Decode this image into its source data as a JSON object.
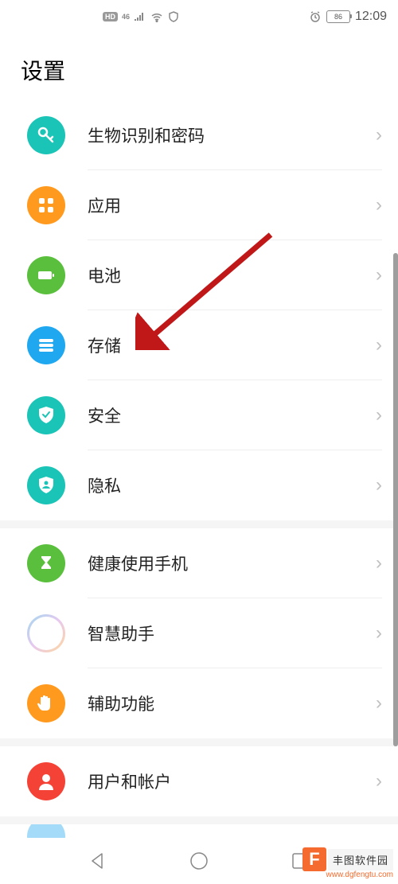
{
  "statusbar": {
    "hd": "HD",
    "net": "46",
    "battery": "86",
    "time": "12:09"
  },
  "title": "设置",
  "groups": [
    {
      "items": [
        {
          "id": "biometric",
          "label": "生物识别和密码",
          "icon": "key",
          "color": "#1ac4b6"
        },
        {
          "id": "apps",
          "label": "应用",
          "icon": "grid",
          "color": "#ff9a1f"
        },
        {
          "id": "battery",
          "label": "电池",
          "icon": "battery",
          "color": "#5abf3d"
        },
        {
          "id": "storage",
          "label": "存储",
          "icon": "storage",
          "color": "#1fa8f0"
        },
        {
          "id": "security",
          "label": "安全",
          "icon": "shield-check",
          "color": "#1ac4b6"
        },
        {
          "id": "privacy",
          "label": "隐私",
          "icon": "shield-person",
          "color": "#1ac4b6"
        }
      ]
    },
    {
      "items": [
        {
          "id": "digital-balance",
          "label": "健康使用手机",
          "icon": "hourglass",
          "color": "#5abf3d"
        },
        {
          "id": "assistant",
          "label": "智慧助手",
          "icon": "ring",
          "color": ""
        },
        {
          "id": "accessibility",
          "label": "辅助功能",
          "icon": "hand",
          "color": "#ff9a1f"
        }
      ]
    },
    {
      "items": [
        {
          "id": "users",
          "label": "用户和帐户",
          "icon": "person",
          "color": "#f44336"
        }
      ]
    }
  ],
  "watermark": {
    "brand": "丰图软件园",
    "url": "www.dgfengtu.com"
  }
}
